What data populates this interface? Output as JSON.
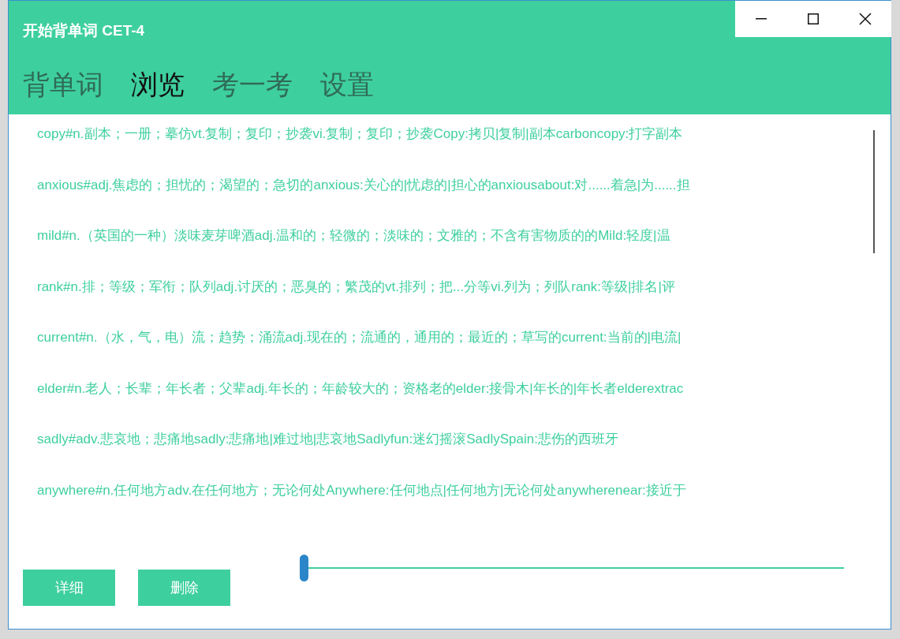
{
  "window": {
    "title": "开始背单词 CET-4"
  },
  "tabs": [
    {
      "label": "背单词",
      "selected": false
    },
    {
      "label": "浏览",
      "selected": true
    },
    {
      "label": "考一考",
      "selected": false
    },
    {
      "label": "设置",
      "selected": false
    }
  ],
  "words": [
    "copy#n.副本；一册；摹仿vt.复制；复印；抄袭vi.复制；复印；抄袭Copy:拷贝|复制|副本carboncopy:打字副本",
    "anxious#adj.焦虑的；担忧的；渴望的；急切的anxious:关心的|忧虑的|担心的anxiousabout:对......着急|为......担",
    "mild#n.（英国的一种）淡味麦芽啤酒adj.温和的；轻微的；淡味的；文雅的；不含有害物质的的Mild:轻度|温",
    "rank#n.排；等级；军衔；队列adj.讨厌的；恶臭的；繁茂的vt.排列；把...分等vi.列为；列队rank:等级|排名|评",
    "current#n.（水，气，电）流；趋势；涌流adj.现在的；流通的，通用的；最近的；草写的current:当前的|电流|",
    "elder#n.老人；长辈；年长者；父辈adj.年长的；年龄较大的；资格老的elder:接骨木|年长的|年长者elderextrac",
    "sadly#adv.悲哀地；悲痛地sadly:悲痛地|难过地|悲哀地Sadlyfun:迷幻摇滚SadlySpain:悲伤的西班牙",
    "anywhere#n.任何地方adv.在任何地方；无论何处Anywhere:任何地点|任何地方|无论何处anywherenear:接近于"
  ],
  "buttons": [
    "详细",
    "删除"
  ],
  "slider": {
    "level": 0
  }
}
